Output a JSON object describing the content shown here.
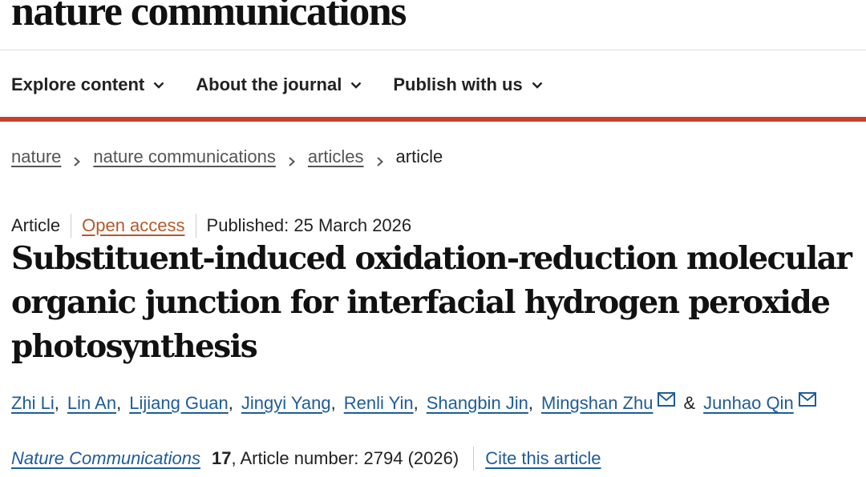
{
  "brand": {
    "logo_text": "nature communications"
  },
  "nav": {
    "items": [
      {
        "label": "Explore content",
        "icon": "chevron-down-icon"
      },
      {
        "label": "About the journal",
        "icon": "chevron-down-icon"
      },
      {
        "label": "Publish with us",
        "icon": "chevron-down-icon"
      }
    ]
  },
  "colors": {
    "accent_bar": "#c7412c",
    "link": "#1f5c99",
    "open_access": "#b45a2a"
  },
  "breadcrumb": {
    "items": [
      "nature",
      "nature communications",
      "articles"
    ],
    "current": "article",
    "separator_icon": "chevron-right-icon"
  },
  "article": {
    "type": "Article",
    "access": "Open access",
    "published": "Published: 25 March 2026",
    "title_lines": [
      "Substituent-induced oxidation-reduction molecular",
      "organic junction for interfacial hydrogen peroxide",
      "photosynthesis"
    ],
    "authors": [
      {
        "name": "Zhi Li",
        "after": ","
      },
      {
        "name": "Lin An",
        "after": ","
      },
      {
        "name": "Lijiang Guan",
        "after": ","
      },
      {
        "name": "Jingyi Yang",
        "after": ","
      },
      {
        "name": "Renli Yin",
        "after": ","
      },
      {
        "name": "Shangbin Jin",
        "after": ","
      },
      {
        "name": "Mingshan Zhu",
        "after": "",
        "icon": "mail-icon"
      }
    ],
    "ampersand": "&",
    "last_author": {
      "name": "Junhao Qin",
      "icon": "mail-icon"
    },
    "citation": {
      "journal": "Nature Communications",
      "volume": "17",
      "rest": ", Article number: 2794 (2026)",
      "cite_link": "Cite this article"
    }
  }
}
